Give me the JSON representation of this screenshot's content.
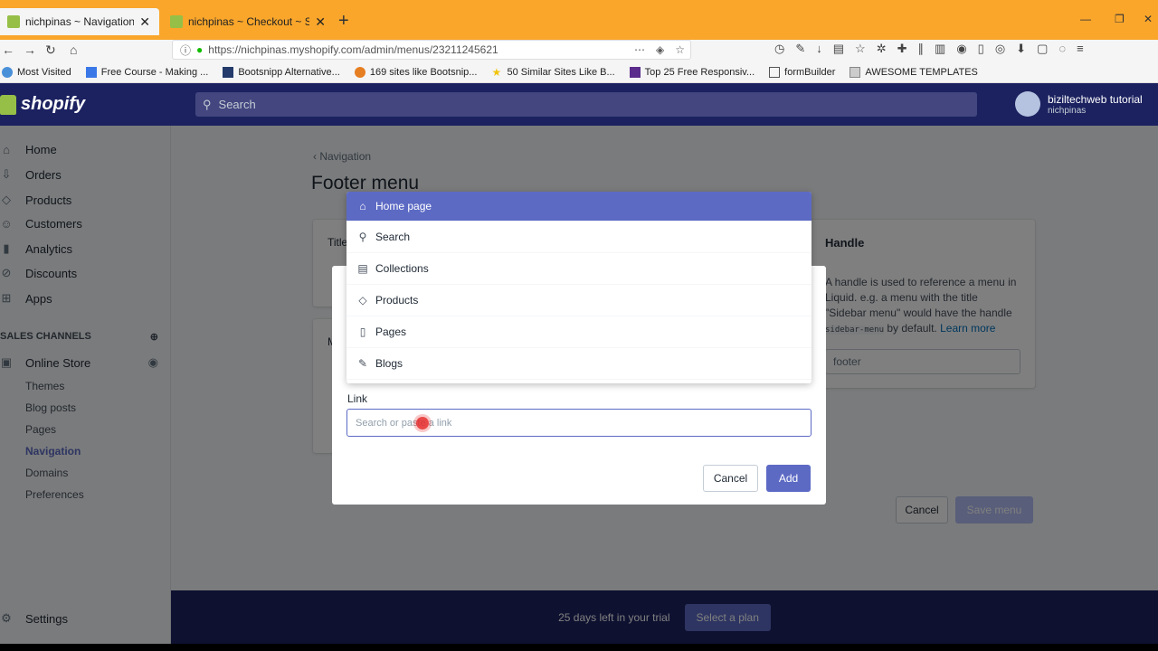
{
  "browser": {
    "tabs": [
      {
        "label": "nichpinas ~ Navigation ~ New",
        "active": true
      },
      {
        "label": "nichpinas ~ Checkout ~ Shopif",
        "active": false
      }
    ],
    "url": "https://nichpinas.myshopify.com/admin/menus/23211245621",
    "bookmarks": [
      {
        "label": "Most Visited",
        "icon": "gear-icon"
      },
      {
        "label": "Free Course - Making ...",
        "icon": "lp-icon"
      },
      {
        "label": "Bootsnipp Alternative...",
        "icon": "a-icon"
      },
      {
        "label": "169 sites like Bootsnip...",
        "icon": "sites-icon"
      },
      {
        "label": "50 Similar Sites Like B...",
        "icon": "star-icon"
      },
      {
        "label": "Top 25 Free Responsiv...",
        "icon": "site-icon"
      },
      {
        "label": "formBuilder",
        "icon": "form-icon"
      },
      {
        "label": "AWESOME TEMPLATES",
        "icon": "folder-icon"
      }
    ]
  },
  "topbar": {
    "logo": "shopify",
    "search_placeholder": "Search",
    "user_name": "biziltechweb tutorial",
    "shop_name": "nichpinas"
  },
  "sidebar": {
    "items": [
      {
        "label": "Home",
        "icon": "home-icon"
      },
      {
        "label": "Orders",
        "icon": "orders-icon"
      },
      {
        "label": "Products",
        "icon": "tag-icon"
      },
      {
        "label": "Customers",
        "icon": "customers-icon"
      },
      {
        "label": "Analytics",
        "icon": "analytics-icon"
      },
      {
        "label": "Discounts",
        "icon": "discount-icon"
      },
      {
        "label": "Apps",
        "icon": "apps-icon"
      }
    ],
    "sales_channels": "SALES CHANNELS",
    "online_store": "Online Store",
    "sub_items": [
      "Themes",
      "Blog posts",
      "Pages",
      "Navigation",
      "Domains",
      "Preferences"
    ],
    "active_sub": "Navigation",
    "settings": "Settings"
  },
  "main": {
    "breadcrumb": "Navigation",
    "title": "Footer menu",
    "title_field_label": "Title",
    "menu_items_label": "M",
    "handle": {
      "title": "Handle",
      "desc_1": "A handle is used to reference a menu in Liquid. e.g. a menu with the title \"Sidebar menu\" would have the handle",
      "desc_code": "sidebar-menu",
      "desc_2": "by default.",
      "learn_more": "Learn more",
      "value": "footer"
    },
    "cancel": "Cancel",
    "save": "Save menu"
  },
  "footer": {
    "trial_text": "25 days left in your trial",
    "plan_button": "Select a plan"
  },
  "modal": {
    "link_label": "Link",
    "link_placeholder": "Search or paste a link",
    "cancel": "Cancel",
    "add": "Add",
    "dropdown": [
      {
        "label": "Home page",
        "icon": "home-icon",
        "active": true
      },
      {
        "label": "Search",
        "icon": "search-icon",
        "active": false
      },
      {
        "label": "Collections",
        "icon": "collections-icon",
        "active": false
      },
      {
        "label": "Products",
        "icon": "tag-icon",
        "active": false
      },
      {
        "label": "Pages",
        "icon": "page-icon",
        "active": false
      },
      {
        "label": "Blogs",
        "icon": "blog-icon",
        "active": false
      }
    ]
  },
  "colors": {
    "shopify_navy": "#1c2260",
    "indigo": "#5c6ac4",
    "firefox_tab_orange": "#f9a62b"
  }
}
